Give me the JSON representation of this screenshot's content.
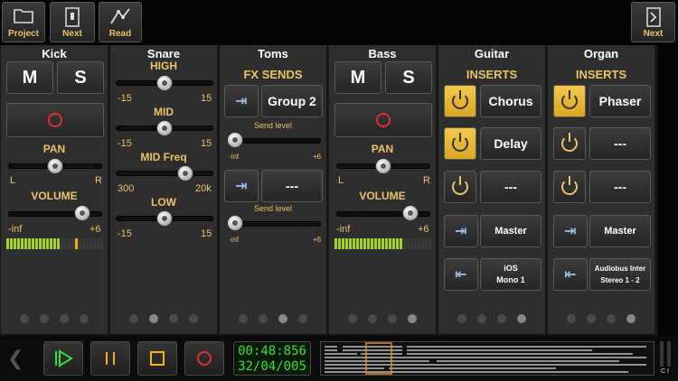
{
  "toolbar": {
    "project_label": "Project",
    "next_label": "Next",
    "read_label": "Read",
    "right_next_label": "Next"
  },
  "strips": {
    "kick": {
      "name": "Kick",
      "mute": "M",
      "solo": "S",
      "pan_label": "PAN",
      "pan_l": "L",
      "pan_r": "R",
      "volume_label": "VOLUME",
      "vol_min": "-inf",
      "vol_max": "+6"
    },
    "snare": {
      "name": "Snare",
      "high_label": "HIGH",
      "mid_label": "MID",
      "midfreq_label": "MID Freq",
      "low_label": "LOW",
      "eq_min": "-15",
      "eq_max": "15",
      "freq_min": "300",
      "freq_max": "20k"
    },
    "toms": {
      "name": "Toms",
      "fx_sends_label": "FX SENDS",
      "send1_name": "Group 2",
      "send2_name": "---",
      "send_level_label": "Send level",
      "send_min": "-inf",
      "send_max": "+6"
    },
    "bass": {
      "name": "Bass",
      "mute": "M",
      "solo": "S",
      "pan_label": "PAN",
      "pan_l": "L",
      "pan_r": "R",
      "volume_label": "VOLUME",
      "vol_min": "-inf",
      "vol_max": "+6"
    },
    "guitar": {
      "name": "Guitar",
      "inserts_label": "INSERTS",
      "insert1": "Chorus",
      "insert2": "Delay",
      "insert3": "---",
      "output": "Master",
      "input_line1": "iOS",
      "input_line2": "Mono 1"
    },
    "organ": {
      "name": "Organ",
      "inserts_label": "INSERTS",
      "insert1": "Phaser",
      "insert2": "---",
      "insert3": "---",
      "output": "Master",
      "input_line1": "Audiobus Inter",
      "input_line2": "Stereo 1 - 2"
    }
  },
  "transport": {
    "time": "00:48:856",
    "bars": "32/04/005",
    "play_color": "#33e03c",
    "pause_color": "#f5b400",
    "stop_color": "#f5b400",
    "record_color": "#e23030"
  },
  "levels": {
    "kick_pan": 0.5,
    "kick_volume": 0.85,
    "bass_pan": 0.5,
    "bass_volume": 0.85,
    "snare_high": 0.5,
    "snare_mid": 0.5,
    "snare_midfreq": 0.75,
    "snare_low": 0.5,
    "toms_send1": 0.0,
    "toms_send2": 0.0
  },
  "colors": {
    "accent": "#e8c36a",
    "power_on": "#f2c94c",
    "meter": "#a7d321",
    "record": "#e23030"
  }
}
